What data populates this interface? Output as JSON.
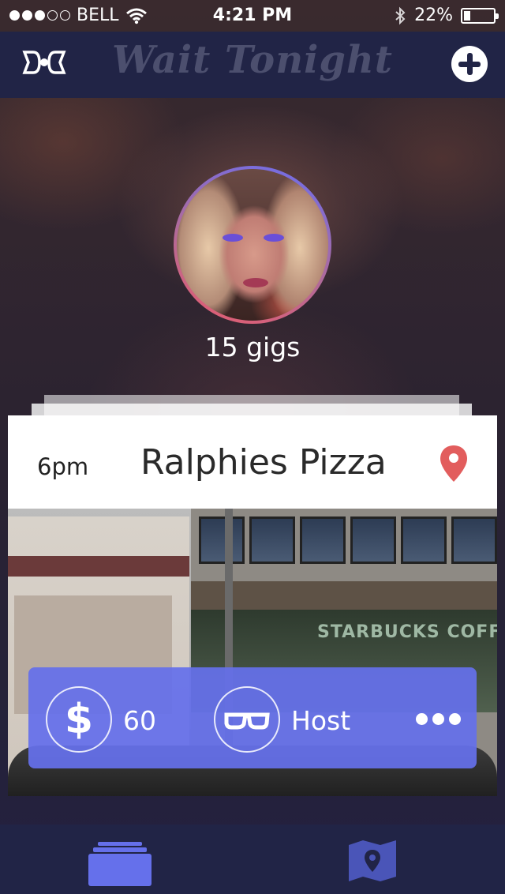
{
  "status_bar": {
    "carrier": "BELL",
    "time": "4:21 PM",
    "battery": "22%",
    "battery_level": 0.22,
    "signal_bars_filled": 3,
    "signal_bars_total": 5
  },
  "nav": {
    "title": "Wait Tonight",
    "logo_icon": "bowtie-logo-icon",
    "add_icon": "plus-circle-icon"
  },
  "profile": {
    "gigs": "15 gigs"
  },
  "gig": {
    "time": "6pm",
    "venue": "Ralphies Pizza",
    "location_icon": "map-pin-icon",
    "photo_sign": "STARBUCKS COFFE",
    "pay": "60",
    "pay_icon": "dollar-icon",
    "role": "Host",
    "role_icon": "glasses-icon",
    "more_icon": "more-dots-icon"
  },
  "tabbar": {
    "items": [
      {
        "name": "cards",
        "icon": "card-stack-icon"
      },
      {
        "name": "map",
        "icon": "map-icon"
      }
    ]
  },
  "colors": {
    "nav_bg": "#212446",
    "accent": "#6570EB",
    "pin": "#E25D5D",
    "title_muted": "#4C4F6E"
  }
}
